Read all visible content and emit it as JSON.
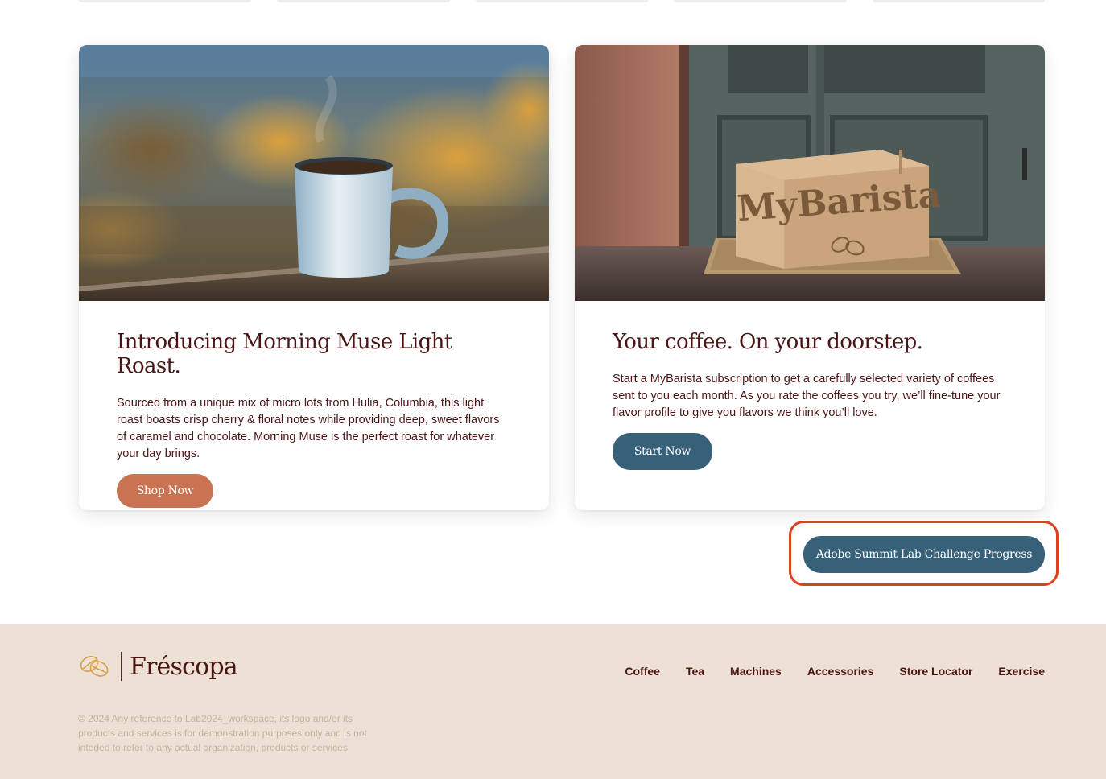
{
  "cards": [
    {
      "title": "Introducing Morning Muse Light Roast.",
      "text": "Sourced from a unique mix of micro lots from Hulia, Columbia, this light roast boasts crisp cherry & floral notes while providing deep, sweet flavors of caramel and chocolate. Morning Muse is the perfect roast for whatever your day brings.",
      "button": "Shop Now"
    },
    {
      "title": "Your coffee. On your doorstep.",
      "text": "Start a MyBarista subscription to get a carefully selected variety of coffees sent to you each month. As you rate the coffees you try, we’ll fine-tune your flavor profile to give you flavors we think you’ll love.",
      "button": "Start Now",
      "box_label": "MyBarista"
    }
  ],
  "challenge_button": "Adobe Summit Lab Challenge Progress",
  "footer": {
    "logo_text": "Fréscopa",
    "nav": [
      "Coffee",
      "Tea",
      "Machines",
      "Accessories",
      "Store Locator",
      "Exercise"
    ],
    "copyright": "© 2024 Any reference to Lab2024_workspace, its logo and/or its products and services is for demonstration purposes only and is not inteded to refer to any actual organization, products or services"
  },
  "colors": {
    "brand_text": "#4a1414",
    "shop_button": "#c97353",
    "primary_button": "#376179",
    "highlight_outline": "#d9431e",
    "footer_bg": "#ede0d4"
  }
}
